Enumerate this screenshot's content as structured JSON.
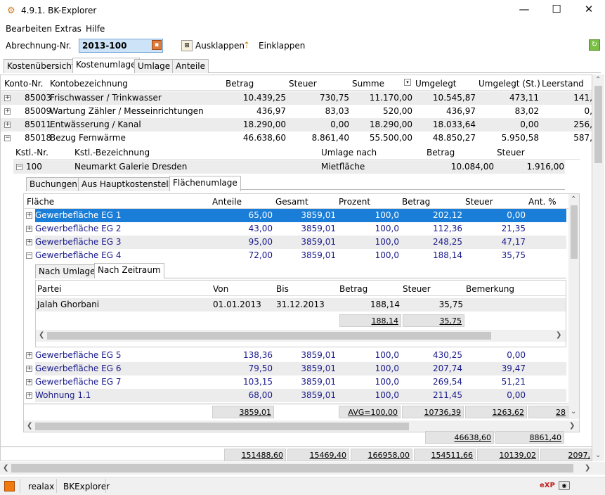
{
  "window": {
    "title": "4.9.1. BK-Explorer",
    "minimize": "—",
    "maximize": "☐",
    "close": "✕"
  },
  "menu": [
    "Bearbeiten",
    "Extras",
    "Hilfe"
  ],
  "toolbar": {
    "abr_label": "Abrechnung-Nr.",
    "abr_value": "2013-100",
    "expand": "Ausklappen",
    "collapse": "Einklappen"
  },
  "main_tabs": [
    "Kostenübersicht",
    "Kostenumlage",
    "Umlage",
    "Anteile"
  ],
  "main_header": [
    "Konto-Nr.",
    "Kontobezeichnung",
    "Betrag",
    "Steuer",
    "Summe",
    "Umgelegt",
    "Umgelegt (St.)",
    "Leerstand"
  ],
  "main_rows": [
    {
      "nr": "85003",
      "name": "Frischwasser / Trinkwasser",
      "betrag": "10.439,25",
      "steuer": "730,75",
      "summe": "11.170,00",
      "umg": "10.545,87",
      "umgst": "473,11",
      "leer": "141,"
    },
    {
      "nr": "85009",
      "name": "Wartung Zähler / Messeinrichtungen",
      "betrag": "436,97",
      "steuer": "83,03",
      "summe": "520,00",
      "umg": "436,97",
      "umgst": "83,02",
      "leer": "0,"
    },
    {
      "nr": "85011",
      "name": "Entwässerung / Kanal",
      "betrag": "18.290,00",
      "steuer": "0,00",
      "summe": "18.290,00",
      "umg": "18.033,64",
      "umgst": "0,00",
      "leer": "256,"
    },
    {
      "nr": "85018",
      "name": "Bezug Fernwärme",
      "betrag": "46.638,60",
      "steuer": "8.861,40",
      "summe": "55.500,00",
      "umg": "48.850,27",
      "umgst": "5.950,58",
      "leer": "587,"
    }
  ],
  "kst_header": [
    "Kstl.-Nr.",
    "Kstl.-Bezeichnung",
    "Umlage nach",
    "Betrag",
    "Steuer"
  ],
  "kst_row": {
    "nr": "100",
    "name": "Neumarkt Galerie Dresden",
    "umlage": "Mietfläche",
    "betrag": "10.084,00",
    "steuer": "1.916,00"
  },
  "sub_tabs": [
    "Buchungen",
    "Aus Hauptkostenstelle",
    "Flächenumlage"
  ],
  "flaeche_header": [
    "Fläche",
    "Anteile",
    "Gesamt",
    "Prozent",
    "Betrag",
    "Steuer",
    "Ant. %"
  ],
  "flaeche_rows_top": [
    {
      "name": "Gewerbefläche EG 1",
      "ant": "65,00",
      "ges": "3859,01",
      "proz": "100,0",
      "bet": "202,12",
      "st": "0,00"
    },
    {
      "name": "Gewerbefläche EG 2",
      "ant": "43,00",
      "ges": "3859,01",
      "proz": "100,0",
      "bet": "112,36",
      "st": "21,35"
    },
    {
      "name": "Gewerbefläche EG 3",
      "ant": "95,00",
      "ges": "3859,01",
      "proz": "100,0",
      "bet": "248,25",
      "st": "47,17"
    },
    {
      "name": "Gewerbefläche EG 4",
      "ant": "72,00",
      "ges": "3859,01",
      "proz": "100,0",
      "bet": "188,14",
      "st": "35,75"
    }
  ],
  "inner_tabs": [
    "Nach Umlage",
    "Nach Zeitraum"
  ],
  "partei_header": [
    "Partei",
    "Von",
    "Bis",
    "Betrag",
    "Steuer",
    "Bemerkung"
  ],
  "partei_row": {
    "name": "Jalah Ghorbani",
    "von": "01.01.2013",
    "bis": "31.12.2013",
    "bet": "188,14",
    "st": "35,75"
  },
  "partei_sum": {
    "bet": "188,14",
    "st": "35,75"
  },
  "flaeche_rows_bottom": [
    {
      "name": "Gewerbefläche EG 5",
      "ant": "138,36",
      "ges": "3859,01",
      "proz": "100,0",
      "bet": "430,25",
      "st": "0,00"
    },
    {
      "name": "Gewerbefläche EG 6",
      "ant": "79,50",
      "ges": "3859,01",
      "proz": "100,0",
      "bet": "207,74",
      "st": "39,47"
    },
    {
      "name": "Gewerbefläche EG 7",
      "ant": "103,15",
      "ges": "3859,01",
      "proz": "100,0",
      "bet": "269,54",
      "st": "51,21"
    },
    {
      "name": "Wohnung 1.1",
      "ant": "68,00",
      "ges": "3859,01",
      "proz": "100,0",
      "bet": "211,45",
      "st": "0,00"
    }
  ],
  "flaeche_sum": {
    "ges": "3859,01",
    "proz": "AVG=100,00",
    "bet": "10736,39",
    "st": "1263,62",
    "ant": "28"
  },
  "kst_sum": {
    "bet": "46638,60",
    "st": "8861,40"
  },
  "main_sum": {
    "betrag": "151488,60",
    "steuer": "15469,40",
    "summe": "166958,00",
    "umg": "154511,66",
    "umgst": "10139,02",
    "leer": "2097,"
  },
  "status": {
    "user": "realax",
    "app": "BKExplorer"
  }
}
